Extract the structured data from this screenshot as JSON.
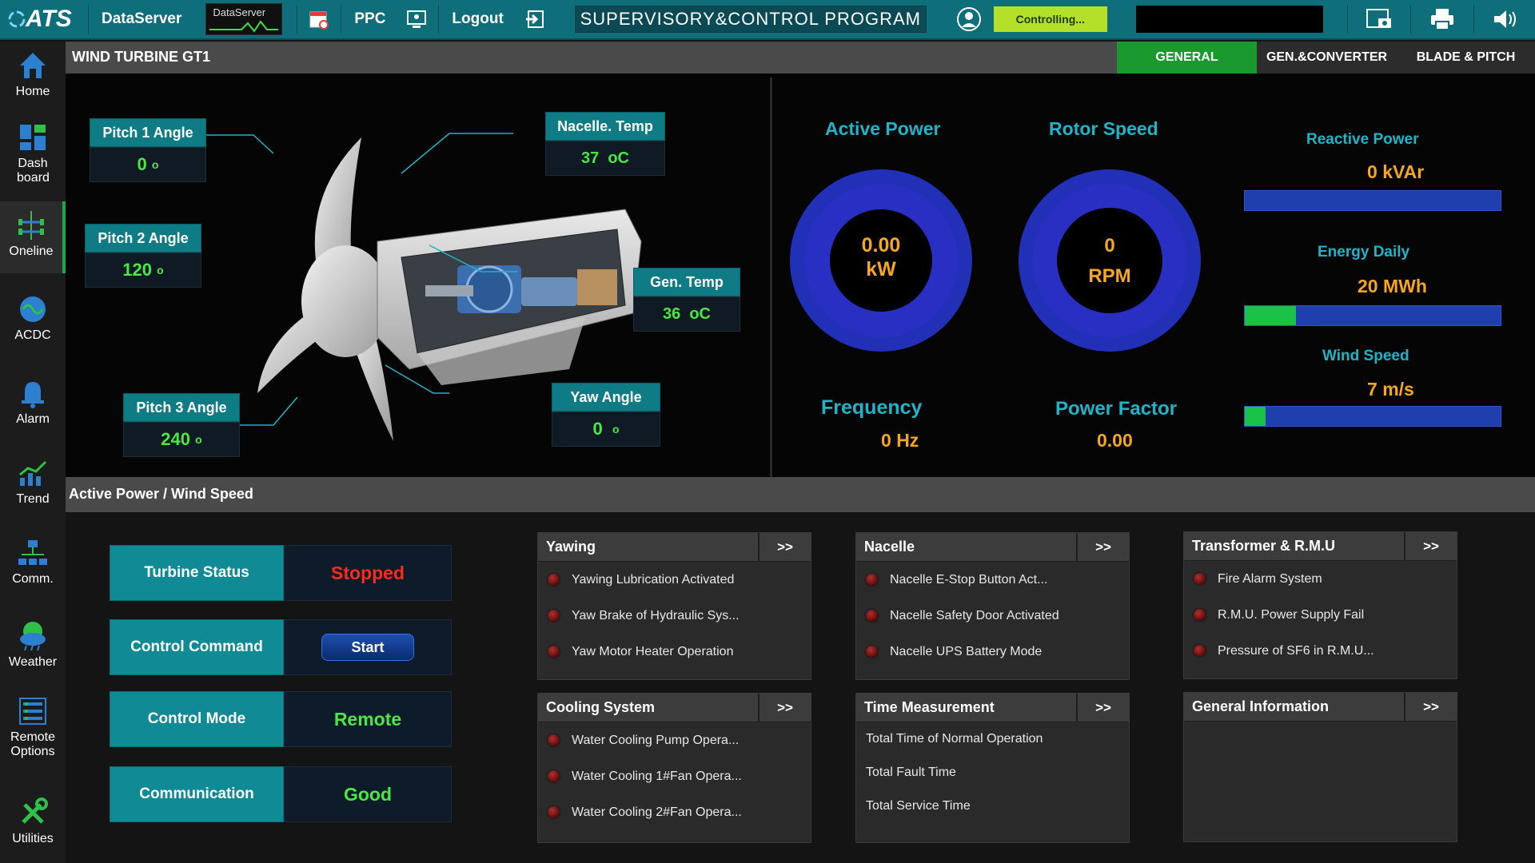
{
  "topbar": {
    "logo": "ATS",
    "dataserver_label": "DataServer",
    "dataserver_box_label": "DataServer",
    "ppc_label": "PPC",
    "logout_label": "Logout",
    "program_title": "SUPERVISORY&CONTROL PROGRAM",
    "controlling_label": "Controlling..."
  },
  "sidebar": {
    "items": [
      {
        "label": "Home",
        "icon": "home-icon"
      },
      {
        "label": "Dash board",
        "icon": "dashboard-icon"
      },
      {
        "label": "Oneline",
        "icon": "oneline-icon"
      },
      {
        "label": "ACDC",
        "icon": "acdc-icon"
      },
      {
        "label": "Alarm",
        "icon": "bell-icon"
      },
      {
        "label": "Trend",
        "icon": "trend-icon"
      },
      {
        "label": "Comm.",
        "icon": "network-icon"
      },
      {
        "label": "Weather",
        "icon": "weather-icon"
      },
      {
        "label": "Remote Options",
        "icon": "remote-icon"
      },
      {
        "label": "Utilities",
        "icon": "tools-icon"
      }
    ]
  },
  "header": {
    "title": "WIND TURBINE  GT1",
    "tabs": [
      "GENERAL",
      "GEN.&CONVERTER",
      "BLADE & PITCH"
    ]
  },
  "turbine": {
    "pitch1": {
      "label": "Pitch 1 Angle",
      "value": "0",
      "unit": "o"
    },
    "pitch2": {
      "label": "Pitch 2 Angle",
      "value": "120",
      "unit": "o"
    },
    "pitch3": {
      "label": "Pitch 3 Angle",
      "value": "240",
      "unit": "o"
    },
    "nacelle_temp": {
      "label": "Nacelle. Temp",
      "value": "37",
      "unit": "oC"
    },
    "gen_temp": {
      "label": "Gen. Temp",
      "value": "36",
      "unit": "oC"
    },
    "yaw": {
      "label": "Yaw Angle",
      "value": "0",
      "unit": "o"
    }
  },
  "gauges": {
    "active_power": {
      "title": "Active Power",
      "value": "0.00",
      "unit": "kW"
    },
    "rotor_speed": {
      "title": "Rotor Speed",
      "value": "0",
      "unit": "RPM"
    },
    "frequency": {
      "title": "Frequency",
      "value": "0",
      "unit": "Hz"
    },
    "power_factor": {
      "title": "Power Factor",
      "value": "0.00"
    }
  },
  "right_metrics": {
    "reactive_power": {
      "label": "Reactive Power",
      "value": "0",
      "unit": "kVAr",
      "fill": 0
    },
    "energy_daily": {
      "label": "Energy Daily",
      "value": "20",
      "unit": "MWh",
      "fill": 0.2
    },
    "wind_speed": {
      "label": "Wind Speed",
      "value": "7",
      "unit": "m/s",
      "fill": 0.08
    }
  },
  "colors": {
    "accent": "#0e7b85",
    "active_tab": "#1a9a2e",
    "value_green": "#49e844",
    "value_orange": "#f5a623",
    "stopped_red": "#ff2a1a"
  },
  "section": {
    "title": "Active Power / Wind Speed"
  },
  "status": {
    "turbine_status": {
      "label": "Turbine Status",
      "value": "Stopped"
    },
    "control_command": {
      "label": "Control Command",
      "button": "Start"
    },
    "control_mode": {
      "label": "Control Mode",
      "value": "Remote"
    },
    "communication": {
      "label": "Communication",
      "value": "Good"
    }
  },
  "panels": {
    "more_label": ">>",
    "yawing": {
      "title": "Yawing",
      "items": [
        "Yawing Lubrication Activated",
        "Yaw Brake of Hydraulic Sys...",
        "Yaw Motor Heater Operation"
      ]
    },
    "nacelle": {
      "title": "Nacelle",
      "items": [
        "Nacelle E-Stop Button Act...",
        "Nacelle Safety Door Activated",
        "Nacelle UPS Battery Mode"
      ]
    },
    "transformer": {
      "title": "Transformer & R.M.U",
      "items": [
        "Fire Alarm System",
        "R.M.U. Power Supply Fail",
        "Pressure of SF6 in R.M.U..."
      ]
    },
    "cooling": {
      "title": "Cooling System",
      "items": [
        "Water Cooling Pump Opera...",
        "Water Cooling 1#Fan Opera...",
        "Water Cooling 2#Fan Opera..."
      ]
    },
    "time": {
      "title": "Time Measurement",
      "items": [
        "Total Time of Normal Operation",
        "Total Fault Time",
        "Total Service Time"
      ]
    },
    "general": {
      "title": "General Information"
    }
  }
}
